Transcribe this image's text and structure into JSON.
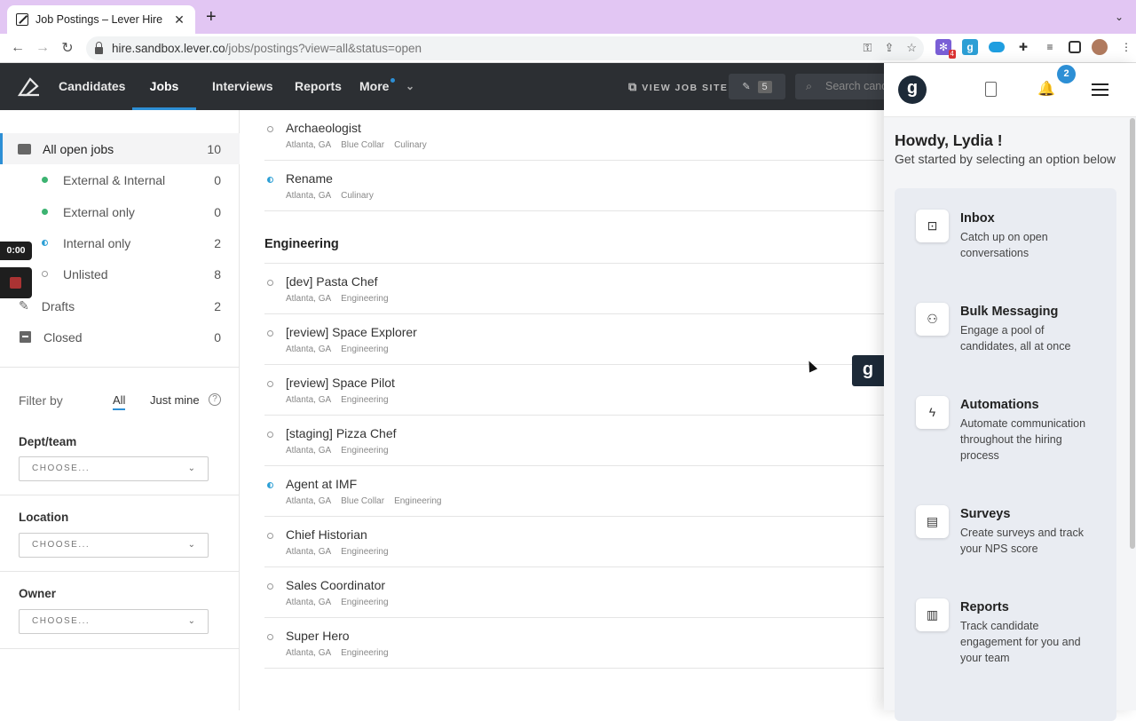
{
  "browser": {
    "tab_title": "Job Postings – Lever Hire",
    "url_host": "hire.sandbox.lever.co",
    "url_path": "/jobs/postings?view=all&status=open",
    "ext_badge": "4"
  },
  "nav": {
    "items": [
      "Candidates",
      "Jobs",
      "Interviews",
      "Reports",
      "More"
    ],
    "view_job_site": "VIEW JOB SITE",
    "drafts_count": "5",
    "search_placeholder": "Search cand"
  },
  "sidebar": {
    "all_open_jobs": {
      "label": "All open jobs",
      "count": "10"
    },
    "sub": [
      {
        "label": "External & Internal",
        "count": "0",
        "color": "#3cb371"
      },
      {
        "label": "External only",
        "count": "0",
        "color": "#3cb371"
      },
      {
        "label": "Internal only",
        "count": "2",
        "color": "#2d9fd5"
      },
      {
        "label": "Unlisted",
        "count": "8",
        "color": "#999999"
      }
    ],
    "drafts": {
      "label": "Drafts",
      "count": "2"
    },
    "closed": {
      "label": "Closed",
      "count": "0"
    },
    "filter_by": "Filter by",
    "filter_all": "All",
    "filter_mine": "Just mine",
    "help": "?",
    "dept_label": "Dept/team",
    "location_label": "Location",
    "owner_label": "Owner",
    "choose": "CHOOSE..."
  },
  "recording": {
    "time": "0:00"
  },
  "jobs_top": [
    {
      "title": "Archaeologist",
      "tags": [
        "Atlanta, GA",
        "Blue Collar",
        "Culinary"
      ],
      "internal": false
    },
    {
      "title": "Rename",
      "tags": [
        "Atlanta, GA",
        "Culinary"
      ],
      "internal": true
    }
  ],
  "group_heading": "Engineering",
  "jobs_eng": [
    {
      "title": "[dev] Pasta Chef",
      "tags": [
        "Atlanta, GA",
        "Engineering"
      ],
      "internal": false
    },
    {
      "title": "[review] Space Explorer",
      "tags": [
        "Atlanta, GA",
        "Engineering"
      ],
      "internal": false
    },
    {
      "title": "[review] Space Pilot",
      "tags": [
        "Atlanta, GA",
        "Engineering"
      ],
      "internal": false
    },
    {
      "title": "[staging] Pizza Chef",
      "tags": [
        "Atlanta, GA",
        "Engineering"
      ],
      "internal": false
    },
    {
      "title": "Agent at IMF",
      "tags": [
        "Atlanta, GA",
        "Blue Collar",
        "Engineering"
      ],
      "internal": true
    },
    {
      "title": "Chief Historian",
      "tags": [
        "Atlanta, GA",
        "Engineering"
      ],
      "internal": false
    },
    {
      "title": "Sales Coordinator",
      "tags": [
        "Atlanta, GA",
        "Engineering"
      ],
      "internal": false
    },
    {
      "title": "Super Hero",
      "tags": [
        "Atlanta, GA",
        "Engineering"
      ],
      "internal": false
    }
  ],
  "panel": {
    "logo": "g",
    "notif_count": "2",
    "greeting": "Howdy, Lydia !",
    "subtitle": "Get started by selecting an option below",
    "cards": [
      {
        "title": "Inbox",
        "desc": "Catch up on open conversations",
        "icon": "inbox-icon"
      },
      {
        "title": "Bulk Messaging",
        "desc": "Engage a pool of candidates, all at once",
        "icon": "people-icon"
      },
      {
        "title": "Automations",
        "desc": "Automate communication throughout the hiring process",
        "icon": "bolt-icon"
      },
      {
        "title": "Surveys",
        "desc": "Create surveys and track your NPS score",
        "icon": "clipboard-icon"
      },
      {
        "title": "Reports",
        "desc": "Track candidate engagement for you and your team",
        "icon": "bar-chart-icon"
      }
    ]
  },
  "float_button": "g"
}
